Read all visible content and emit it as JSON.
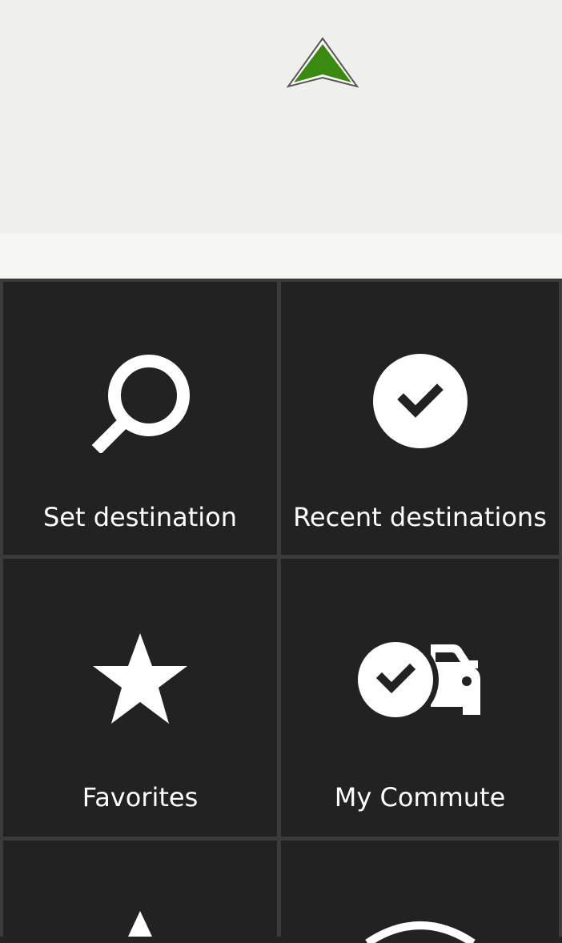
{
  "map": {
    "position_marker_color": "#3a8a12"
  },
  "menu": {
    "tiles": [
      {
        "label": "Set destination",
        "icon": "search-icon"
      },
      {
        "label": "Recent destinations",
        "icon": "check-circle-icon"
      },
      {
        "label": "Favorites",
        "icon": "star-icon"
      },
      {
        "label": "My Commute",
        "icon": "commute-icon"
      },
      {
        "label": "",
        "icon": "navigation-arrow-icon"
      },
      {
        "label": "",
        "icon": "circle-icon"
      }
    ]
  }
}
